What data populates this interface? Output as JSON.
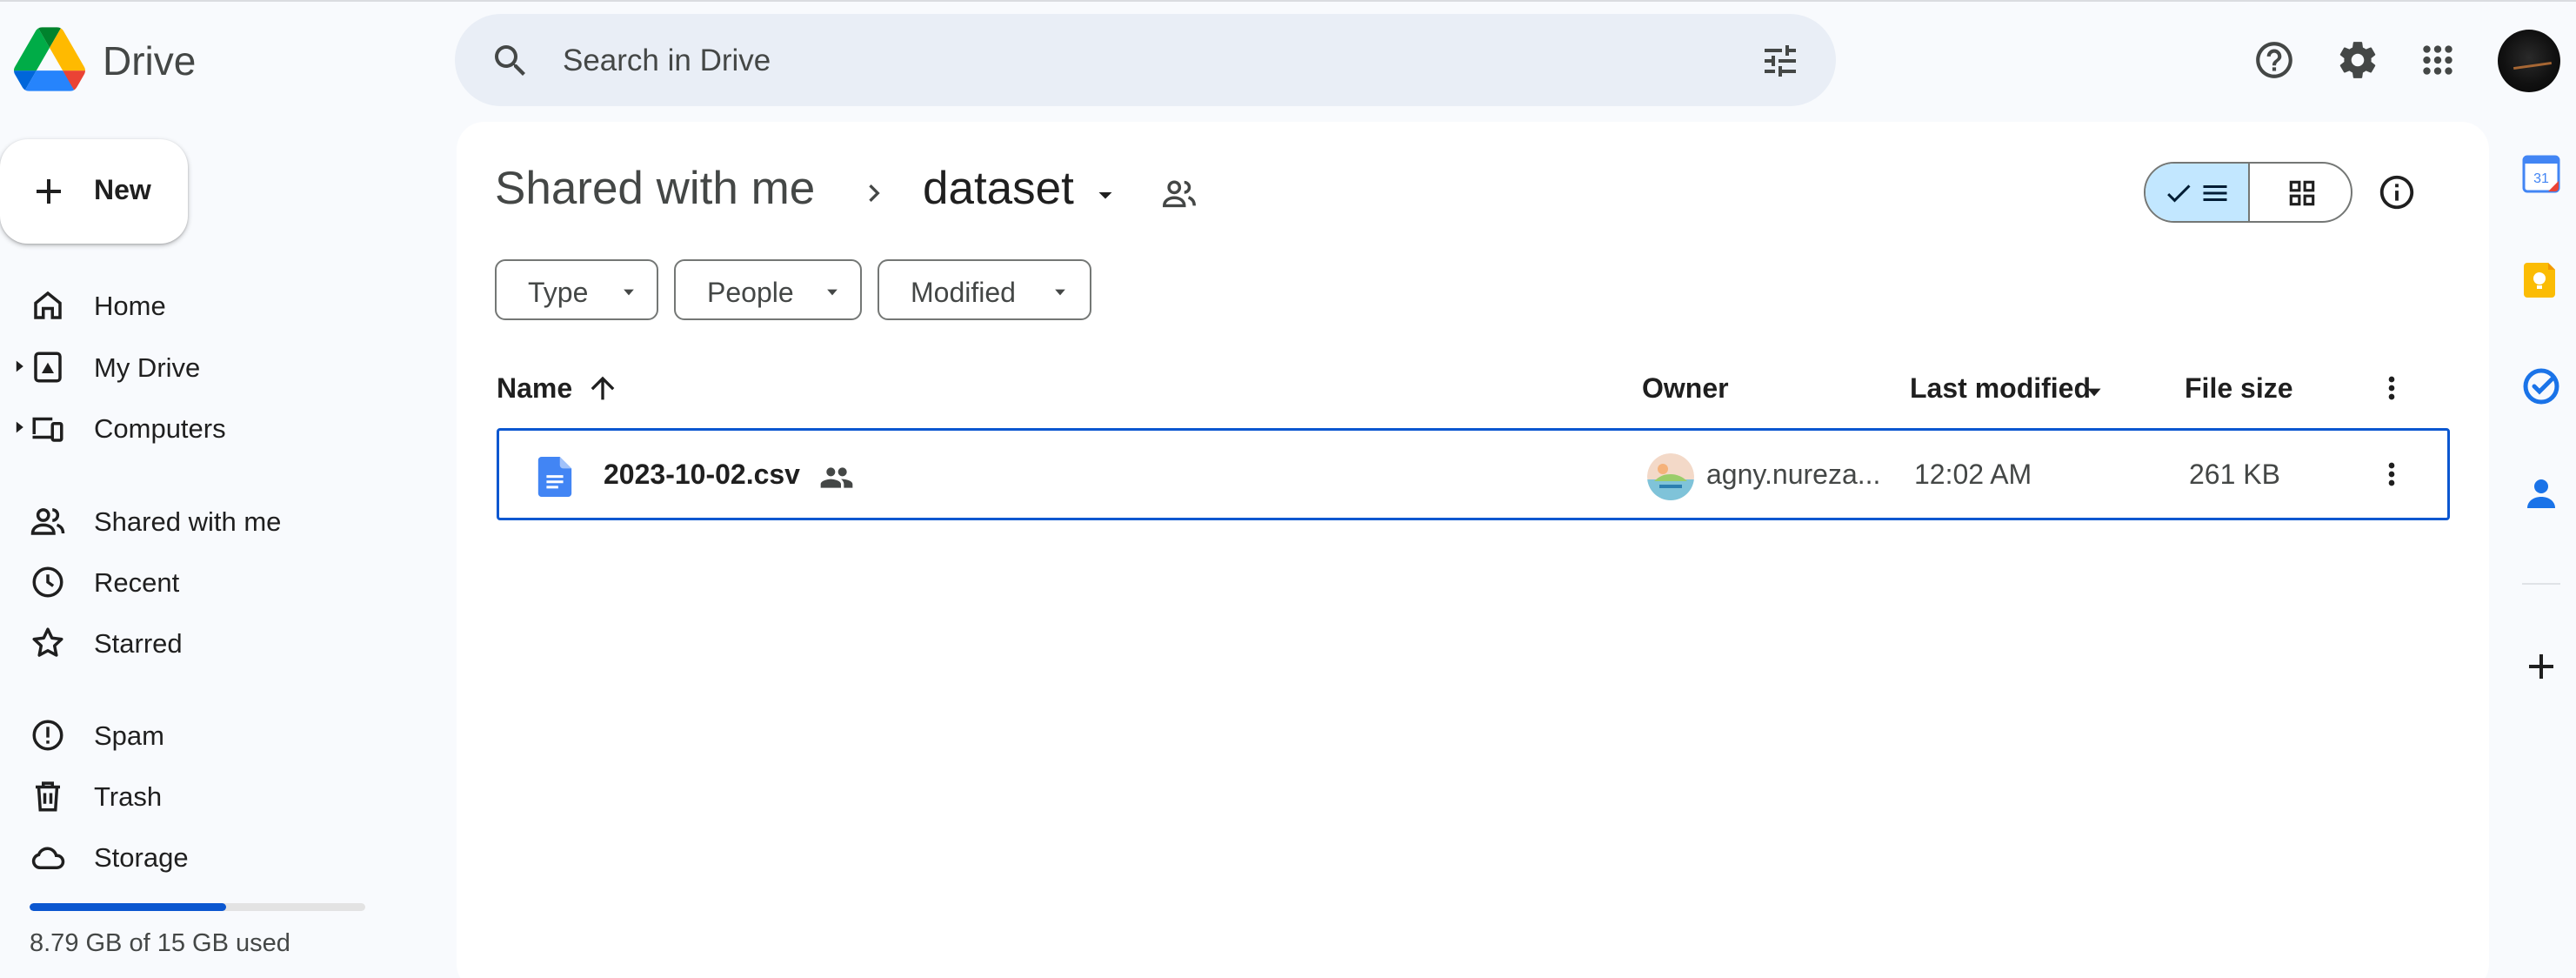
{
  "app": {
    "name": "Drive"
  },
  "search": {
    "placeholder": "Search in Drive"
  },
  "sidebar": {
    "new_label": "New",
    "items": [
      {
        "label": "Home"
      },
      {
        "label": "My Drive"
      },
      {
        "label": "Computers"
      },
      {
        "label": "Shared with me"
      },
      {
        "label": "Recent"
      },
      {
        "label": "Starred"
      },
      {
        "label": "Spam"
      },
      {
        "label": "Trash"
      },
      {
        "label": "Storage"
      }
    ],
    "storage": {
      "used_text": "8.79 GB of 15 GB used",
      "used_fraction": 0.586
    }
  },
  "breadcrumb": {
    "root": "Shared with me",
    "current": "dataset"
  },
  "view": {
    "mode": "list"
  },
  "filters": [
    {
      "label": "Type"
    },
    {
      "label": "People"
    },
    {
      "label": "Modified"
    }
  ],
  "table": {
    "columns": {
      "name": "Name",
      "owner": "Owner",
      "modified": "Last modified",
      "size": "File size"
    },
    "rows": [
      {
        "name": "2023-10-02.csv",
        "owner": "agny.nureza...",
        "modified": "12:02 AM",
        "size": "261 KB",
        "shared": true,
        "selected": true
      }
    ]
  },
  "colors": {
    "accent": "#0b57d0",
    "selected_toggle": "#c2e7ff",
    "search_bg": "#e9eef6"
  },
  "icons": {
    "header": [
      "search-icon",
      "tune-icon",
      "help-icon",
      "settings-icon",
      "apps-icon"
    ],
    "side_panel": [
      "calendar-icon",
      "keep-icon",
      "tasks-icon",
      "contacts-icon",
      "add-icon"
    ],
    "calendar_day": "31"
  }
}
